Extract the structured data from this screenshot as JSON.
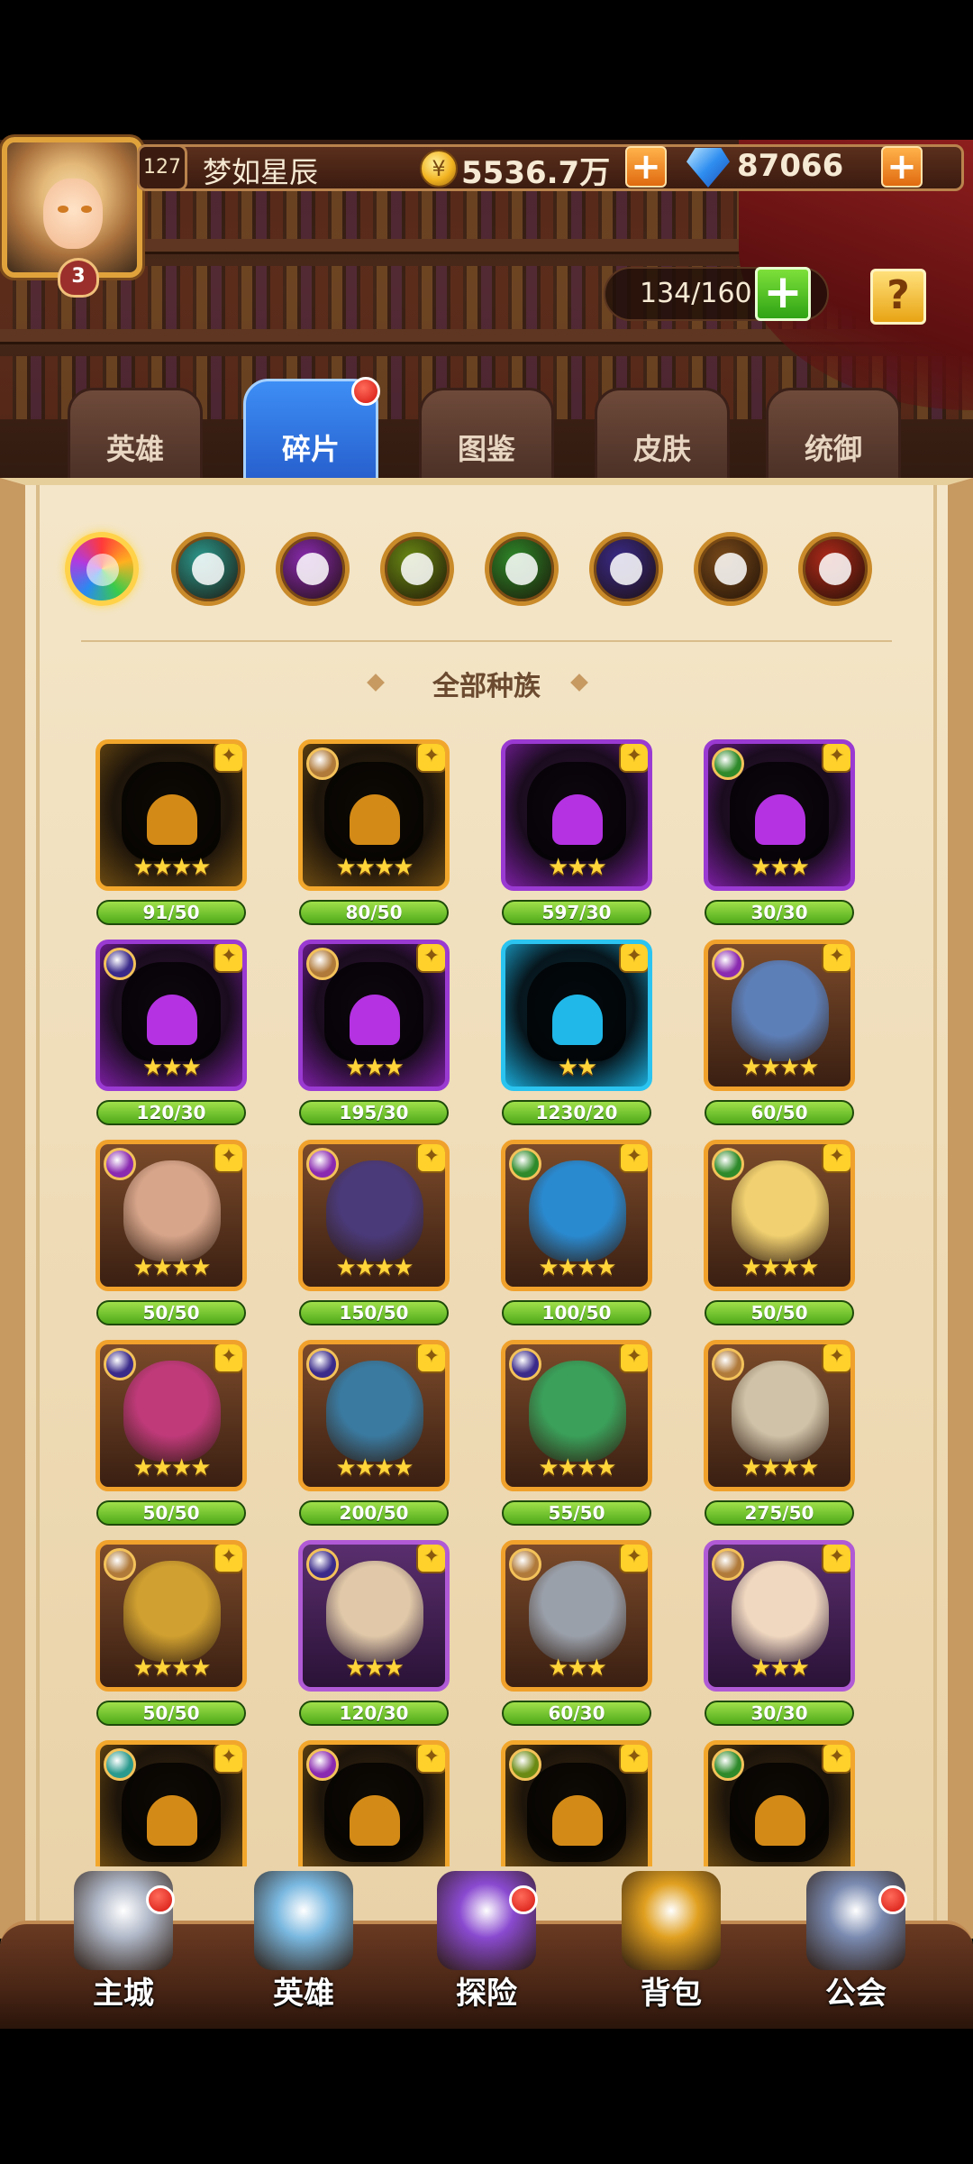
{
  "player": {
    "level": "127",
    "name": "梦如星辰",
    "avatar_badge": "3"
  },
  "currency": {
    "coin_icon": "coin-icon",
    "coins": "5536.7万",
    "gem_icon": "gem-icon",
    "gems": "87066"
  },
  "capacity": {
    "text": "134/160"
  },
  "help": {
    "label": "?"
  },
  "tabs": [
    {
      "label": "英雄",
      "active": false
    },
    {
      "label": "碎片",
      "active": true,
      "badge": true
    },
    {
      "label": "图鉴",
      "active": false
    },
    {
      "label": "皮肤",
      "active": false
    },
    {
      "label": "统御",
      "active": false
    }
  ],
  "race_filters": [
    {
      "name": "all",
      "color": "#f2553a"
    },
    {
      "name": "race-1",
      "color": "#2b9a8e"
    },
    {
      "name": "race-2",
      "color": "#8a2ab0"
    },
    {
      "name": "race-3",
      "color": "#6a8a14"
    },
    {
      "name": "race-4",
      "color": "#2e8a2a"
    },
    {
      "name": "race-5",
      "color": "#3a2a8a"
    },
    {
      "name": "race-6",
      "color": "#7a4a1a"
    },
    {
      "name": "race-7",
      "color": "#b02a1a"
    }
  ],
  "section_title": "全部种族",
  "cards": [
    {
      "type": "gold",
      "stars": "★★★★",
      "progress": "91/50",
      "fill": 1.0
    },
    {
      "type": "gold",
      "stars": "★★★★",
      "progress": "80/50",
      "fill": 1.0,
      "race": "#b07a3a"
    },
    {
      "type": "purple",
      "stars": "★★★",
      "progress": "597/30",
      "fill": 1.0
    },
    {
      "type": "purple",
      "stars": "★★★",
      "progress": "30/30",
      "fill": 1.0,
      "race": "#2e8a2a"
    },
    {
      "type": "purple",
      "stars": "★★★",
      "progress": "120/30",
      "fill": 1.0,
      "race": "#3a2a8a"
    },
    {
      "type": "purple",
      "stars": "★★★",
      "progress": "195/30",
      "fill": 1.0,
      "race": "#b07a3a"
    },
    {
      "type": "cyan",
      "stars": "★★",
      "progress": "1230/20",
      "fill": 1.0
    },
    {
      "type": "hero",
      "stars": "★★★★",
      "progress": "60/50",
      "fill": 1.0,
      "race": "#8a2ab0",
      "portrait": "#5d7fb8"
    },
    {
      "type": "hero",
      "stars": "★★★★",
      "progress": "50/50",
      "fill": 1.0,
      "race": "#8a2ab0",
      "portrait": "#d7a58a"
    },
    {
      "type": "hero",
      "stars": "★★★★",
      "progress": "150/50",
      "fill": 1.0,
      "race": "#8a2ab0",
      "portrait": "#4a3a7a"
    },
    {
      "type": "hero",
      "stars": "★★★★",
      "progress": "100/50",
      "fill": 1.0,
      "race": "#2e8a2a",
      "portrait": "#2a8ad0"
    },
    {
      "type": "hero",
      "stars": "★★★★",
      "progress": "50/50",
      "fill": 1.0,
      "race": "#2e8a2a",
      "portrait": "#f0d070"
    },
    {
      "type": "hero",
      "stars": "★★★★",
      "progress": "50/50",
      "fill": 1.0,
      "race": "#3a2a8a",
      "portrait": "#c03a7a"
    },
    {
      "type": "hero",
      "stars": "★★★★",
      "progress": "200/50",
      "fill": 1.0,
      "race": "#3a2a8a",
      "portrait": "#3a7aa0"
    },
    {
      "type": "hero",
      "stars": "★★★★",
      "progress": "55/50",
      "fill": 1.0,
      "race": "#3a2a8a",
      "portrait": "#3aa05a"
    },
    {
      "type": "hero",
      "stars": "★★★★",
      "progress": "275/50",
      "fill": 1.0,
      "race": "#b07a3a",
      "portrait": "#cfc2a8"
    },
    {
      "type": "hero",
      "stars": "★★★★",
      "progress": "50/50",
      "fill": 1.0,
      "race": "#b07a3a",
      "portrait": "#d0a030"
    },
    {
      "type": "hero violet",
      "stars": "★★★",
      "progress": "120/30",
      "fill": 1.0,
      "race": "#3a2a8a",
      "portrait": "#e0c8a8"
    },
    {
      "type": "hero",
      "stars": "★★★",
      "progress": "60/30",
      "fill": 1.0,
      "race": "#b07a3a",
      "portrait": "#9aa0aa"
    },
    {
      "type": "hero violet",
      "stars": "★★★",
      "progress": "30/30",
      "fill": 1.0,
      "race": "#b07a3a",
      "portrait": "#f0d8c0"
    },
    {
      "type": "gold",
      "stars": "",
      "progress": "",
      "fill": 0,
      "race": "#2b9a8e"
    },
    {
      "type": "gold",
      "stars": "",
      "progress": "",
      "fill": 0,
      "race": "#8a2ab0"
    },
    {
      "type": "gold",
      "stars": "",
      "progress": "",
      "fill": 0,
      "race": "#6a8a14"
    },
    {
      "type": "gold",
      "stars": "",
      "progress": "",
      "fill": 0,
      "race": "#2e8a2a"
    }
  ],
  "bottom_nav": [
    {
      "label": "主城",
      "icon": "castle-icon",
      "color": "#b0b8c8",
      "badge": true
    },
    {
      "label": "英雄",
      "icon": "hero-icon",
      "color": "#7ab8e0",
      "badge": false
    },
    {
      "label": "探险",
      "icon": "portal-icon",
      "color": "#8a4ad0",
      "badge": true
    },
    {
      "label": "背包",
      "icon": "bag-icon",
      "color": "#e0a020",
      "badge": false
    },
    {
      "label": "公会",
      "icon": "guild-icon",
      "color": "#7a8ab0",
      "badge": true
    }
  ]
}
